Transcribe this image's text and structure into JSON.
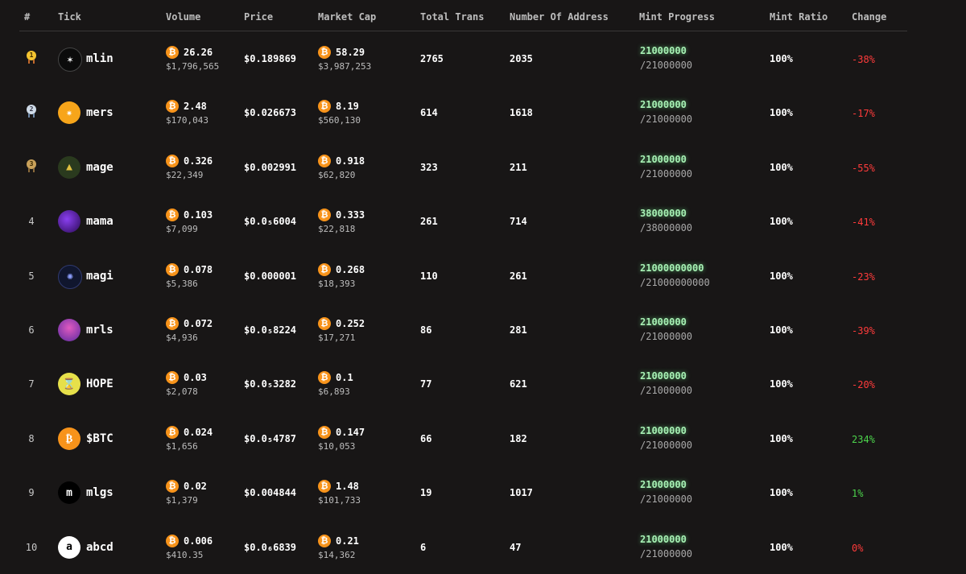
{
  "headers": {
    "rank": "#",
    "tick": "Tick",
    "volume": "Volume",
    "price": "Price",
    "market_cap": "Market Cap",
    "total_trans": "Total Trans",
    "addresses": "Number Of Address",
    "mint_progress": "Mint Progress",
    "mint_ratio": "Mint Ratio",
    "change": "Change"
  },
  "accent_colors": {
    "bitcoin": "#f7931a",
    "positive": "#4cd44c",
    "negative": "#ff3b3b",
    "mint_glow": "#a7f0b4"
  },
  "rows": [
    {
      "rank": "1",
      "medal": "gold",
      "medal_label": "1",
      "icon": "mlin-star-icon",
      "avatar_glyph": "✶",
      "tick": "mlin",
      "volume_btc": "26.26",
      "volume_usd": "$1,796,565",
      "price": "$0.189869",
      "mcap_btc": "58.29",
      "mcap_usd": "$3,987,253",
      "trans": "2765",
      "addresses": "2035",
      "mint_top": "21000000",
      "mint_bottom": "/21000000",
      "ratio": "100%",
      "change": "-38%",
      "change_dir": "neg"
    },
    {
      "rank": "2",
      "medal": "silver",
      "medal_label": "2",
      "icon": "mers-burst-icon",
      "avatar_glyph": "✷",
      "tick": "mers",
      "volume_btc": "2.48",
      "volume_usd": "$170,043",
      "price": "$0.026673",
      "mcap_btc": "8.19",
      "mcap_usd": "$560,130",
      "trans": "614",
      "addresses": "1618",
      "mint_top": "21000000",
      "mint_bottom": "/21000000",
      "ratio": "100%",
      "change": "-17%",
      "change_dir": "neg"
    },
    {
      "rank": "3",
      "medal": "bronze",
      "medal_label": "3",
      "icon": "mage-wizard-icon",
      "avatar_glyph": "▲",
      "tick": "mage",
      "volume_btc": "0.326",
      "volume_usd": "$22,349",
      "price": "$0.002991",
      "mcap_btc": "0.918",
      "mcap_usd": "$62,820",
      "trans": "323",
      "addresses": "211",
      "mint_top": "21000000",
      "mint_bottom": "/21000000",
      "ratio": "100%",
      "change": "-55%",
      "change_dir": "neg"
    },
    {
      "rank": "4",
      "medal": "",
      "medal_label": "",
      "icon": "mama-purple-icon",
      "avatar_glyph": "",
      "tick": "mama",
      "volume_btc": "0.103",
      "volume_usd": "$7,099",
      "price": "$0.0₅6004",
      "mcap_btc": "0.333",
      "mcap_usd": "$22,818",
      "trans": "261",
      "addresses": "714",
      "mint_top": "38000000",
      "mint_bottom": "/38000000",
      "ratio": "100%",
      "change": "-41%",
      "change_dir": "neg"
    },
    {
      "rank": "5",
      "medal": "",
      "medal_label": "",
      "icon": "magi-circle-icon",
      "avatar_glyph": "✺",
      "tick": "magi",
      "volume_btc": "0.078",
      "volume_usd": "$5,386",
      "price": "$0.000001",
      "mcap_btc": "0.268",
      "mcap_usd": "$18,393",
      "trans": "110",
      "addresses": "261",
      "mint_top": "21000000000",
      "mint_bottom": "/21000000000",
      "ratio": "100%",
      "change": "-23%",
      "change_dir": "neg"
    },
    {
      "rank": "6",
      "medal": "",
      "medal_label": "",
      "icon": "mrls-character-icon",
      "avatar_glyph": "",
      "tick": "mrls",
      "volume_btc": "0.072",
      "volume_usd": "$4,936",
      "price": "$0.0₅8224",
      "mcap_btc": "0.252",
      "mcap_usd": "$17,271",
      "trans": "86",
      "addresses": "281",
      "mint_top": "21000000",
      "mint_bottom": "/21000000",
      "ratio": "100%",
      "change": "-39%",
      "change_dir": "neg"
    },
    {
      "rank": "7",
      "medal": "",
      "medal_label": "",
      "icon": "hope-hourglass-icon",
      "avatar_glyph": "⌛",
      "tick": "HOPE",
      "volume_btc": "0.03",
      "volume_usd": "$2,078",
      "price": "$0.0₅3282",
      "mcap_btc": "0.1",
      "mcap_usd": "$6,893",
      "trans": "77",
      "addresses": "621",
      "mint_top": "21000000",
      "mint_bottom": "/21000000",
      "ratio": "100%",
      "change": "-20%",
      "change_dir": "neg"
    },
    {
      "rank": "8",
      "medal": "",
      "medal_label": "",
      "icon": "bitcoin-icon",
      "avatar_glyph": "₿",
      "tick": "$BTC",
      "volume_btc": "0.024",
      "volume_usd": "$1,656",
      "price": "$0.0₅4787",
      "mcap_btc": "0.147",
      "mcap_usd": "$10,053",
      "trans": "66",
      "addresses": "182",
      "mint_top": "21000000",
      "mint_bottom": "/21000000",
      "ratio": "100%",
      "change": "234%",
      "change_dir": "pos"
    },
    {
      "rank": "9",
      "medal": "",
      "medal_label": "",
      "icon": "letter-m-icon",
      "avatar_glyph": "m",
      "tick": "mlgs",
      "volume_btc": "0.02",
      "volume_usd": "$1,379",
      "price": "$0.004844",
      "mcap_btc": "1.48",
      "mcap_usd": "$101,733",
      "trans": "19",
      "addresses": "1017",
      "mint_top": "21000000",
      "mint_bottom": "/21000000",
      "ratio": "100%",
      "change": "1%",
      "change_dir": "pos"
    },
    {
      "rank": "10",
      "medal": "",
      "medal_label": "",
      "icon": "letter-a-icon",
      "avatar_glyph": "a",
      "tick": "abcd",
      "volume_btc": "0.006",
      "volume_usd": "$410.35",
      "price": "$0.0₆6839",
      "mcap_btc": "0.21",
      "mcap_usd": "$14,362",
      "trans": "6",
      "addresses": "47",
      "mint_top": "21000000",
      "mint_bottom": "/21000000",
      "ratio": "100%",
      "change": "0%",
      "change_dir": "neg"
    }
  ]
}
